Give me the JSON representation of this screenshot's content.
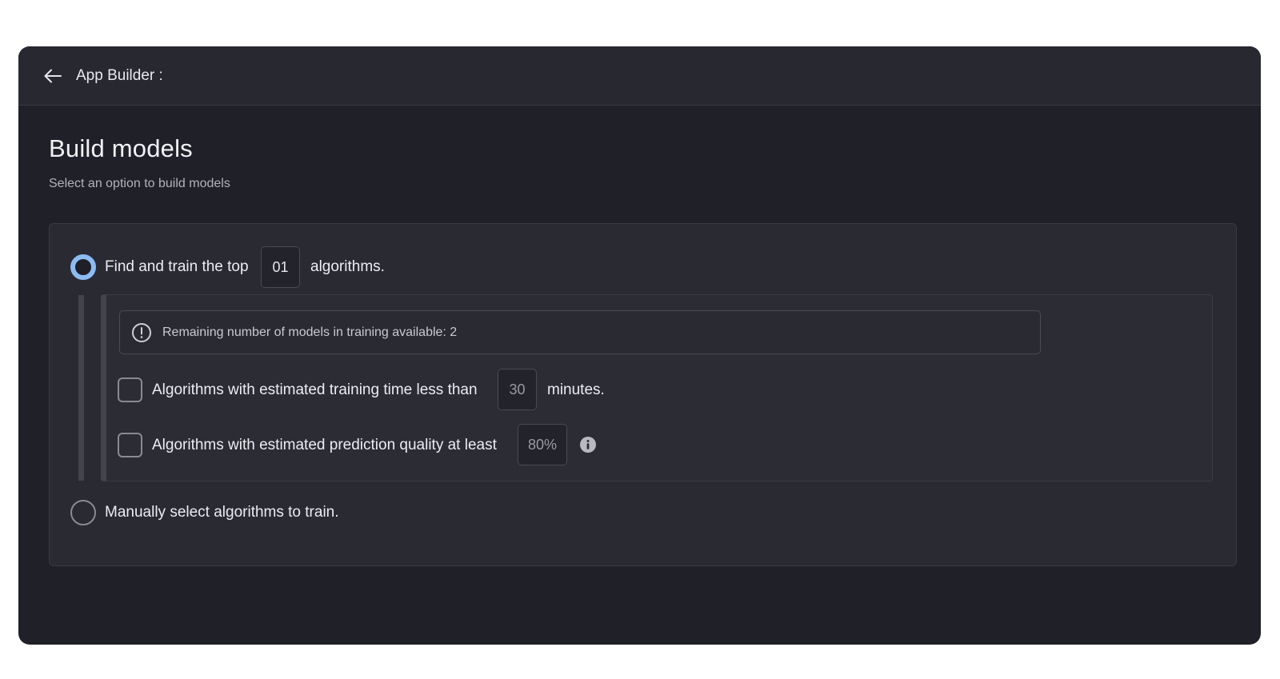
{
  "header": {
    "title": "App Builder :"
  },
  "page": {
    "title": "Build models",
    "subtitle": "Select an option to build models"
  },
  "options": {
    "find_top": {
      "label_before": "Find and train the top",
      "count": "01",
      "label_after": "algorithms.",
      "selected": true
    },
    "manual": {
      "label": "Manually select algorithms to train.",
      "selected": false
    }
  },
  "banner": {
    "text": "Remaining number of models in training available:  2"
  },
  "filters": {
    "training_time": {
      "label_before": "Algorithms with estimated training time less than",
      "value": "30",
      "label_after": "minutes.",
      "checked": false
    },
    "prediction_quality": {
      "label_before": "Algorithms with estimated prediction quality at least",
      "value": "80%",
      "checked": false
    }
  },
  "colors": {
    "accent": "#8cbcf4",
    "window_bg": "#202028",
    "card_bg": "#2a2a33"
  },
  "icons": {
    "back": "arrow-left-icon",
    "banner": "exclamation-circle-icon",
    "help": "info-circle-icon"
  }
}
